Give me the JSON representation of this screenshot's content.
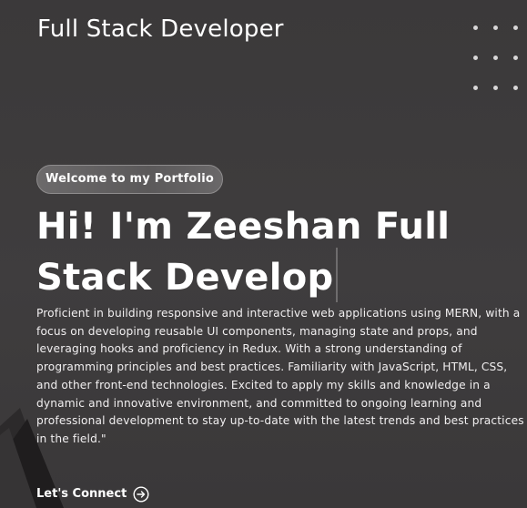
{
  "header": {
    "title": "Full Stack Developer"
  },
  "decor": {
    "dot_grid_icon": "dot-grid-icon",
    "shape_icon": "diagonal-shape-icon"
  },
  "hero": {
    "badge": "Welcome to my Portfolio",
    "heading": "Hi! I'm Zeeshan Full Stack Develop",
    "bio": "Proficient in building responsive and interactive web applications using MERN, with a focus on developing reusable UI components, managing state and props, and leveraging hooks and proficiency in Redux. With a strong understanding of programming principles and best practices. Familiarity with JavaScript, HTML, CSS, and other front-end technologies. Excited to apply my skills and knowledge in a dynamic and innovative environment, and committed to ongoing learning and professional development to stay up-to-date with the latest trends and best practices in the field.\""
  },
  "cta": {
    "label": "Let's Connect",
    "icon": "arrow-right-circle-icon"
  },
  "colors": {
    "background": "#3d3b3c",
    "text": "#ffffff",
    "badge_border": "#8e8c8d"
  }
}
